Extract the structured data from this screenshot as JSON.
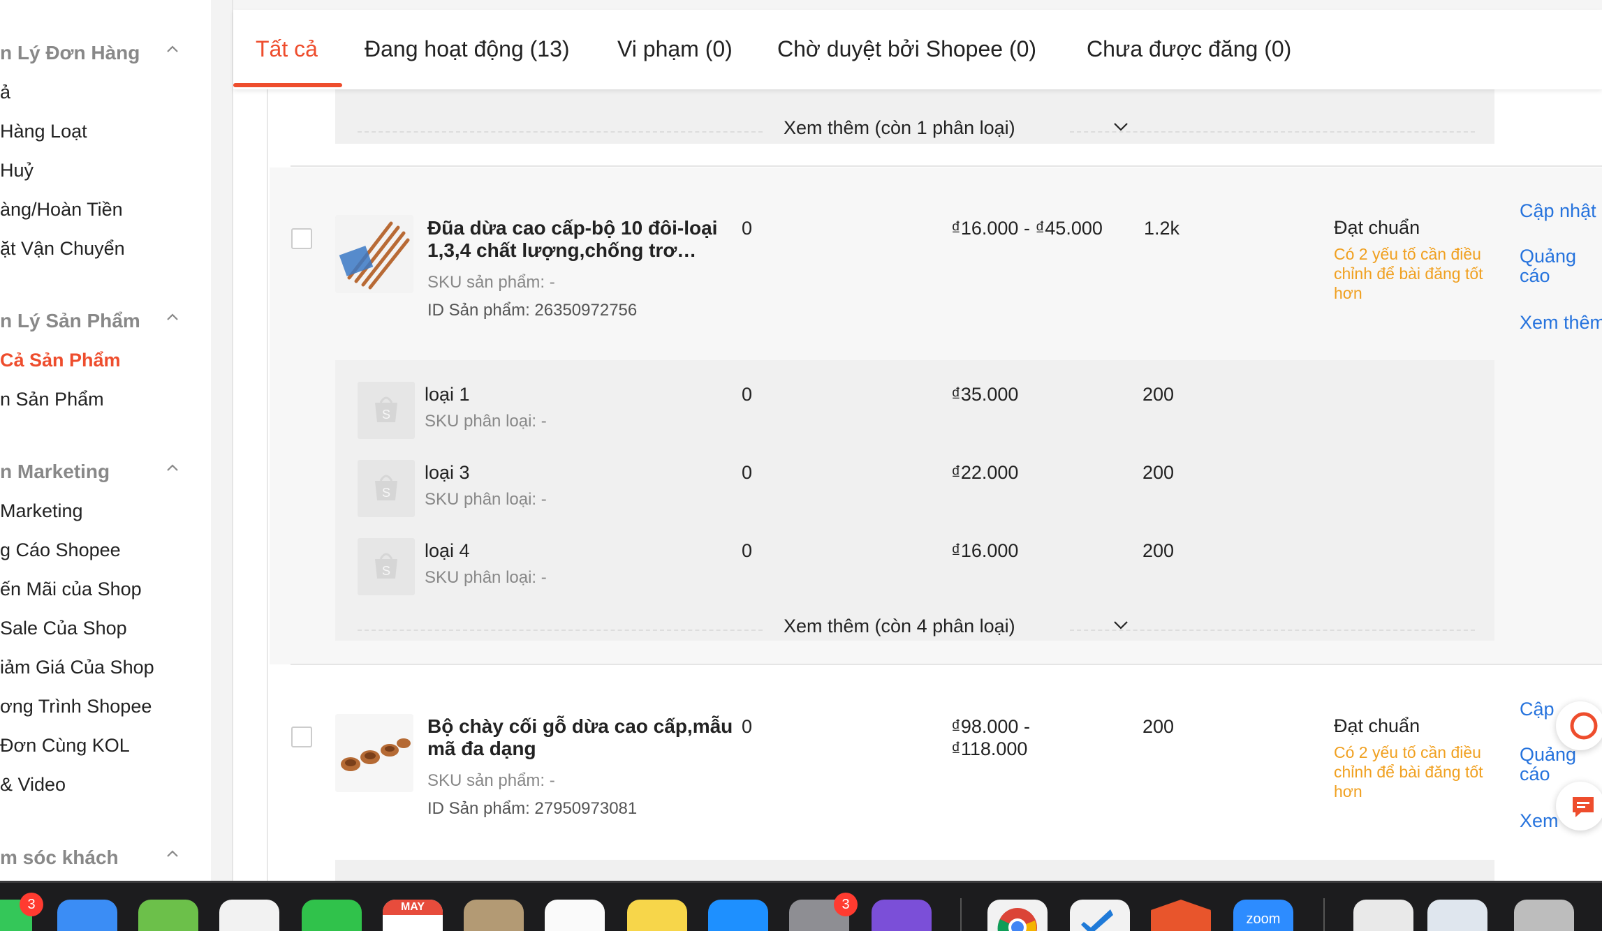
{
  "sidebar": {
    "sections": [
      {
        "label": "n Lý Đơn Hàng",
        "items": [
          "ả",
          "Hàng Loạt",
          "Huỷ",
          "àng/Hoàn Tiền",
          "ặt Vận Chuyển"
        ]
      },
      {
        "label": "n Lý Sản Phẩm",
        "items": [
          "Cả Sản Phẩm",
          "n Sản Phẩm"
        ],
        "active_index": 0
      },
      {
        "label": "n Marketing",
        "items": [
          " Marketing",
          "g Cáo Shopee",
          "ến Mãi của Shop",
          " Sale Của Shop",
          "iảm Giá Của Shop",
          "ơng Trình Shopee",
          " Đơn Cùng KOL",
          "& Video"
        ]
      },
      {
        "label": "m sóc khách",
        "items": []
      }
    ]
  },
  "tabs": [
    {
      "label": "Tất cả",
      "active": true
    },
    {
      "label": "Đang hoạt động (13)"
    },
    {
      "label": "Vi phạm (0)"
    },
    {
      "label": "Chờ duyệt bởi Shopee (0)"
    },
    {
      "label": "Chưa được đăng (0)"
    }
  ],
  "more_top": "Xem thêm (còn 1 phân loại)",
  "products": [
    {
      "name": "Đũa dừa cao cấp-bộ 10 đôi-loại 1,3,4 chất lượng,chống trơ…",
      "sku": "SKU sản phẩm: -",
      "id": "ID Sản phẩm: 26350972756",
      "sales": "0",
      "price": "₫16.000 - ₫45.000",
      "stock": "1.2k",
      "status": "Đạt chuẩn",
      "status_note": "Có 2 yếu tố cần điều chỉnh để bài đăng tốt hơn",
      "actions": [
        "Cập nhật",
        "Quảng cáo",
        "Xem thêm"
      ],
      "variants": [
        {
          "name": "loại 1",
          "sku": "SKU phân loại: -",
          "sales": "0",
          "price": "₫35.000",
          "stock": "200"
        },
        {
          "name": "loại 3",
          "sku": "SKU phân loại: -",
          "sales": "0",
          "price": "₫22.000",
          "stock": "200"
        },
        {
          "name": "loại 4",
          "sku": "SKU phân loại: -",
          "sales": "0",
          "price": "₫16.000",
          "stock": "200"
        }
      ],
      "more_variants": "Xem thêm (còn 4 phân loại)"
    },
    {
      "name": "Bộ chày cối gỗ dừa cao cấp,mẫu mã đa dạng",
      "sku": "SKU sản phẩm: -",
      "id": "ID Sản phẩm: 27950973081",
      "sales": "0",
      "price_line1": "₫98.000 -",
      "price_line2": "₫118.000",
      "stock": "200",
      "status": "Đạt chuẩn",
      "status_note": "Có 2 yếu tố cần điều chỉnh để bài đăng tốt hơn",
      "actions": [
        "Cập",
        "Quảng cáo",
        "Xem"
      ]
    }
  ],
  "dock": {
    "calendar_month": "MAY",
    "badges": {
      "messages": "3",
      "settings": "3"
    },
    "zoom_label": "zoom"
  },
  "colors": {
    "accent": "#ee4d2d",
    "link": "#2673dd",
    "warning": "#f0a020"
  }
}
